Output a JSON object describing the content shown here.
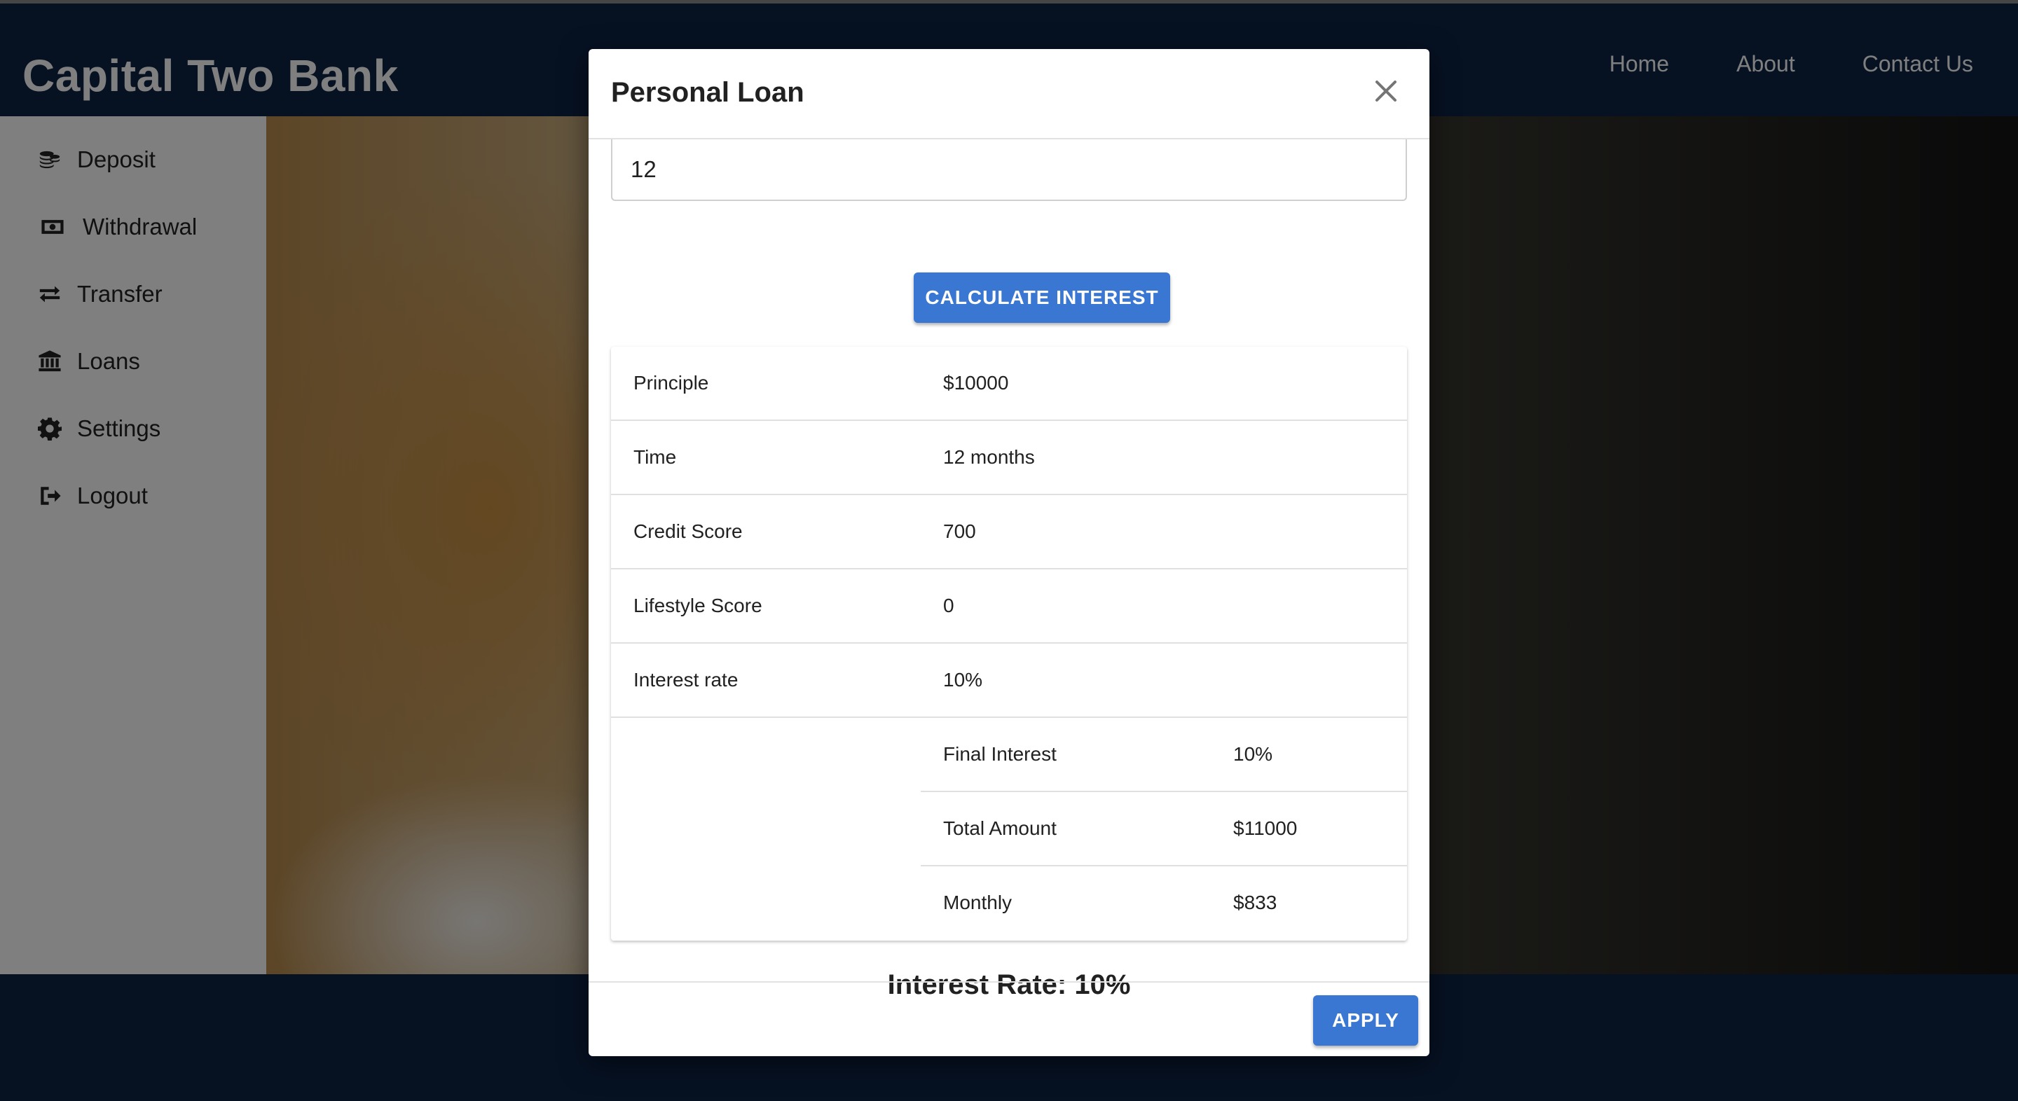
{
  "header": {
    "brand": "Capital Two Bank",
    "nav": [
      "Home",
      "About",
      "Contact Us"
    ]
  },
  "sidebar": {
    "items": [
      {
        "label": "Deposit",
        "icon": "coins-icon"
      },
      {
        "label": "Withdrawal",
        "icon": "money-bill-icon"
      },
      {
        "label": "Transfer",
        "icon": "exchange-icon"
      },
      {
        "label": "Loans",
        "icon": "bank-icon"
      },
      {
        "label": "Settings",
        "icon": "gear-icon"
      },
      {
        "label": "Logout",
        "icon": "sign-out-icon"
      }
    ]
  },
  "modal": {
    "title": "Personal Loan",
    "months_value": "12",
    "calculate_label": "CALCULATE INTEREST",
    "rows": [
      {
        "label": "Principle",
        "value": "$10000"
      },
      {
        "label": "Time",
        "value": "12 months"
      },
      {
        "label": "Credit Score",
        "value": "700"
      },
      {
        "label": "Lifestyle Score",
        "value": "0"
      },
      {
        "label": "Interest rate",
        "value": "10%"
      }
    ],
    "subrows": [
      {
        "label": "Final Interest",
        "value": "10%"
      },
      {
        "label": "Total Amount",
        "value": "$11000"
      },
      {
        "label": "Monthly",
        "value": "$833"
      }
    ],
    "summary": "Interest Rate: 10%",
    "apply_label": "APPLY"
  },
  "colors": {
    "header_bg": "#0c2244",
    "primary_button": "#3a77d2"
  }
}
